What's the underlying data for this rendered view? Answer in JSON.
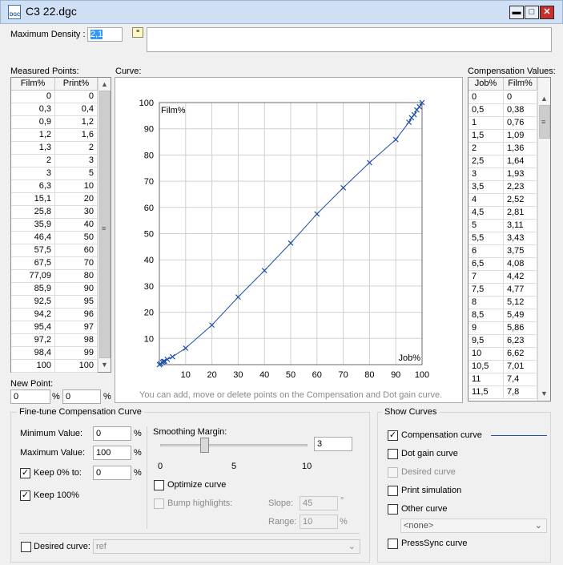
{
  "window": {
    "title": "C3 22.dgc",
    "icon": "dgc-file-icon",
    "icon_text": "DGC",
    "buttons": [
      "minimize-icon",
      "maximize-icon",
      "close-icon"
    ]
  },
  "top": {
    "max_density_label": "Maximum Density :",
    "max_density_value": "2,1",
    "notes_value": ""
  },
  "measured": {
    "label": "Measured Points:",
    "headers": [
      "Film%",
      "Print%"
    ],
    "rows": [
      [
        "0",
        "0"
      ],
      [
        "0,3",
        "0,4"
      ],
      [
        "0,9",
        "1,2"
      ],
      [
        "1,2",
        "1,6"
      ],
      [
        "1,3",
        "2"
      ],
      [
        "2",
        "3"
      ],
      [
        "3",
        "5"
      ],
      [
        "6,3",
        "10"
      ],
      [
        "15,1",
        "20"
      ],
      [
        "25,8",
        "30"
      ],
      [
        "35,9",
        "40"
      ],
      [
        "46,4",
        "50"
      ],
      [
        "57,5",
        "60"
      ],
      [
        "67,5",
        "70"
      ],
      [
        "77,09",
        "80"
      ],
      [
        "85,9",
        "90"
      ],
      [
        "92,5",
        "95"
      ],
      [
        "94,2",
        "96"
      ],
      [
        "95,4",
        "97"
      ],
      [
        "97,2",
        "98"
      ],
      [
        "98,4",
        "99"
      ],
      [
        "100",
        "100"
      ]
    ]
  },
  "new_point": {
    "label": "New Point:",
    "film_value": "0",
    "print_value": "0",
    "unit": "%"
  },
  "curve": {
    "label": "Curve:",
    "hint": "You can add, move or delete points on the Compensation and Dot gain curve."
  },
  "chart_data": {
    "type": "line",
    "xlabel": "Job%",
    "ylabel": "Film%",
    "xlim": [
      0,
      100
    ],
    "ylim": [
      0,
      100
    ],
    "grid": true,
    "x_ticks": [
      "10",
      "20",
      "30",
      "40",
      "50",
      "60",
      "70",
      "80",
      "90",
      "100"
    ],
    "y_ticks": [
      "10",
      "20",
      "30",
      "40",
      "50",
      "60",
      "70",
      "80",
      "90",
      "100"
    ],
    "series": [
      {
        "color": "#1f4fa8",
        "x": [
          0,
          0.4,
          1.2,
          1.6,
          2,
          3,
          5,
          10,
          20,
          30,
          40,
          50,
          60,
          70,
          80,
          90,
          95,
          96,
          97,
          98,
          99,
          100
        ],
        "y": [
          0,
          0.3,
          0.9,
          1.2,
          1.3,
          2,
          3,
          6.3,
          15.1,
          25.8,
          35.9,
          46.4,
          57.5,
          67.5,
          77.09,
          85.9,
          92.5,
          94.2,
          95.4,
          97.2,
          98.4,
          100
        ]
      }
    ]
  },
  "compensation": {
    "label": "Compensation Values:",
    "headers": [
      "Job%",
      "Film%"
    ],
    "rows": [
      [
        "0",
        "0"
      ],
      [
        "0,5",
        "0,38"
      ],
      [
        "1",
        "0,76"
      ],
      [
        "1,5",
        "1,09"
      ],
      [
        "2",
        "1,36"
      ],
      [
        "2,5",
        "1,64"
      ],
      [
        "3",
        "1,93"
      ],
      [
        "3,5",
        "2,23"
      ],
      [
        "4",
        "2,52"
      ],
      [
        "4,5",
        "2,81"
      ],
      [
        "5",
        "3,11"
      ],
      [
        "5,5",
        "3,43"
      ],
      [
        "6",
        "3,75"
      ],
      [
        "6,5",
        "4,08"
      ],
      [
        "7",
        "4,42"
      ],
      [
        "7,5",
        "4,77"
      ],
      [
        "8",
        "5,12"
      ],
      [
        "8,5",
        "5,49"
      ],
      [
        "9",
        "5,86"
      ],
      [
        "9,5",
        "6,23"
      ],
      [
        "10",
        "6,62"
      ],
      [
        "10,5",
        "7,01"
      ],
      [
        "11",
        "7,4"
      ],
      [
        "11,5",
        "7,8"
      ]
    ]
  },
  "finetune": {
    "title": "Fine-tune Compensation Curve",
    "min_label": "Minimum Value:",
    "min_value": "0",
    "max_label": "Maximum Value:",
    "max_value": "100",
    "keep0_label": "Keep 0% to:",
    "keep0_value": "0",
    "keep0_checked": true,
    "keep100_label": "Keep 100%",
    "keep100_checked": true,
    "unit": "%",
    "smoothing_label": "Smoothing Margin:",
    "smoothing_value": "3",
    "smoothing_level": 3,
    "slider_ticks": [
      "0",
      "5",
      "10"
    ],
    "optimize_label": "Optimize curve",
    "bump_label": "Bump highlights:",
    "slope_label": "Slope:",
    "slope_value": "45",
    "slope_unit": "°",
    "range_label": "Range:",
    "range_value": "10",
    "range_unit": "%",
    "desired_label": "Desired curve:",
    "desired_value": "ref"
  },
  "show_curves": {
    "title": "Show Curves",
    "items": [
      {
        "label": "Compensation curve",
        "checked": true,
        "enabled": true
      },
      {
        "label": "Dot gain curve",
        "checked": false,
        "enabled": true
      },
      {
        "label": "Desired curve",
        "checked": false,
        "enabled": false
      },
      {
        "label": "Print simulation",
        "checked": false,
        "enabled": true
      },
      {
        "label": "Other curve",
        "checked": false,
        "enabled": true
      },
      {
        "label": "PressSync curve",
        "checked": false,
        "enabled": true
      }
    ],
    "other_select": "<none>",
    "comp_line_color": "#1f4fa8"
  }
}
